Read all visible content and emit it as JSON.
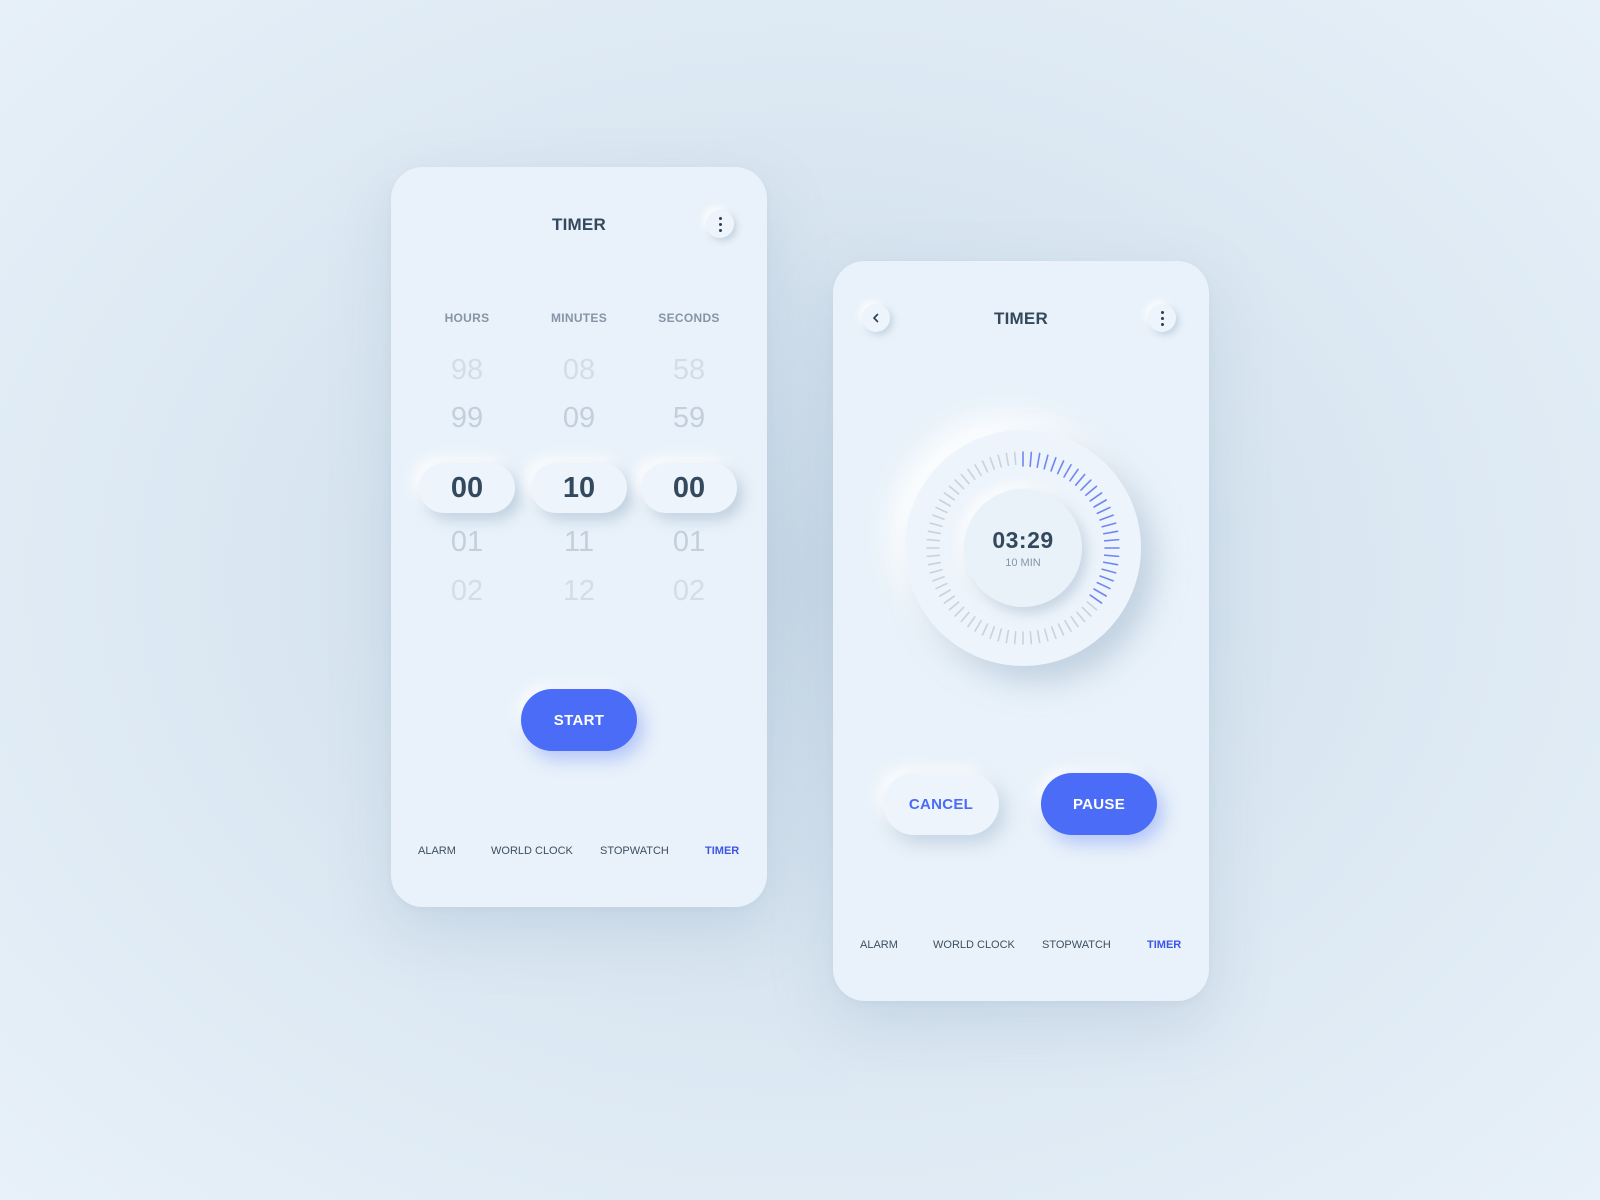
{
  "accent_color": "#4a6cf7",
  "setup": {
    "title": "TIMER",
    "menu_icon": "more-vertical-icon",
    "columns": [
      {
        "label": "HOURS",
        "above": [
          "98",
          "99"
        ],
        "selected": "00",
        "below": [
          "01",
          "02"
        ]
      },
      {
        "label": "MINUTES",
        "above": [
          "08",
          "09"
        ],
        "selected": "10",
        "below": [
          "11",
          "12"
        ]
      },
      {
        "label": "SECONDS",
        "above": [
          "58",
          "59"
        ],
        "selected": "00",
        "below": [
          "01",
          "02"
        ]
      }
    ],
    "start_label": "START",
    "nav": [
      "ALARM",
      "WORLD CLOCK",
      "STOPWATCH",
      "TIMER"
    ],
    "active_nav": "TIMER"
  },
  "running": {
    "title": "TIMER",
    "back_icon": "chevron-left-icon",
    "menu_icon": "more-vertical-icon",
    "remaining": "03:29",
    "duration": "10 MIN",
    "progress_fraction": 0.35,
    "cancel_label": "CANCEL",
    "pause_label": "PAUSE",
    "nav": [
      "ALARM",
      "WORLD CLOCK",
      "STOPWATCH",
      "TIMER"
    ],
    "active_nav": "TIMER"
  }
}
